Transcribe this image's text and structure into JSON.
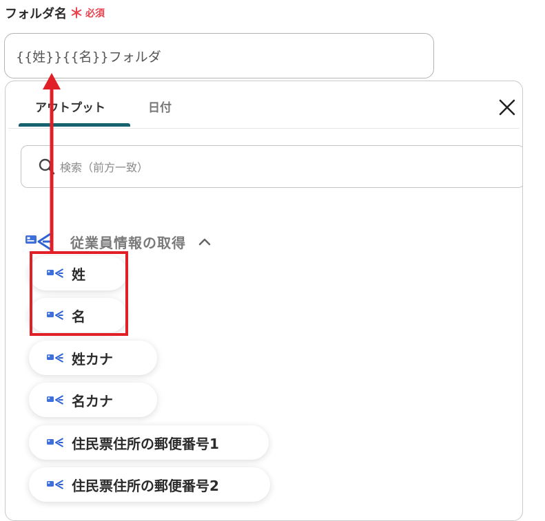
{
  "field": {
    "label": "フォルダ名",
    "required_mark": "＊",
    "required_text": "必須",
    "value": "{{姓}}{{名}}フォルダ"
  },
  "tabs": [
    {
      "label": "アウトプット",
      "active": true
    },
    {
      "label": "日付",
      "active": false
    }
  ],
  "search": {
    "placeholder": "検索（前方一致）"
  },
  "group": {
    "title": "従業員情報の取得",
    "expanded": true
  },
  "items": [
    {
      "label": "姓"
    },
    {
      "label": "名"
    },
    {
      "label": "姓カナ"
    },
    {
      "label": "名カナ"
    },
    {
      "label": "住民票住所の郵便番号1"
    },
    {
      "label": "住民票住所の郵便番号2"
    }
  ],
  "colors": {
    "accent": "#16636f",
    "required": "#e8414d",
    "annotation": "#e01f26",
    "icon_blue": "#2f62d6"
  },
  "icons": {
    "close": "close-icon",
    "search": "search-icon",
    "group": "employee-db-icon",
    "item": "employee-db-icon",
    "collapse": "chevron-up-icon"
  }
}
